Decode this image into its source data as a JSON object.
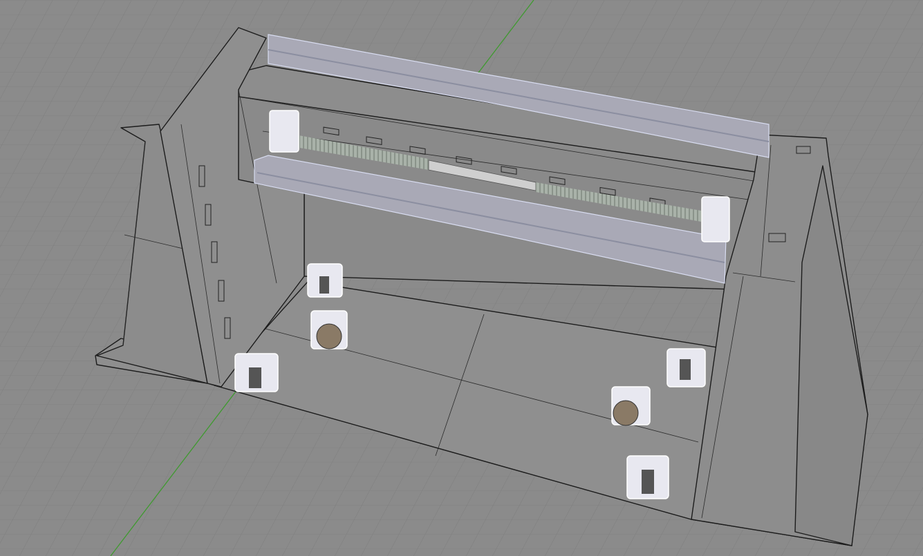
{
  "viewport": {
    "background_color": "#8b8b8b",
    "grid_color": "#7d7d7d",
    "y_axis_color": "#3f9a2f",
    "model_surface_color": "#8e8e8e",
    "selected_part_color": "#e8e8f0"
  }
}
